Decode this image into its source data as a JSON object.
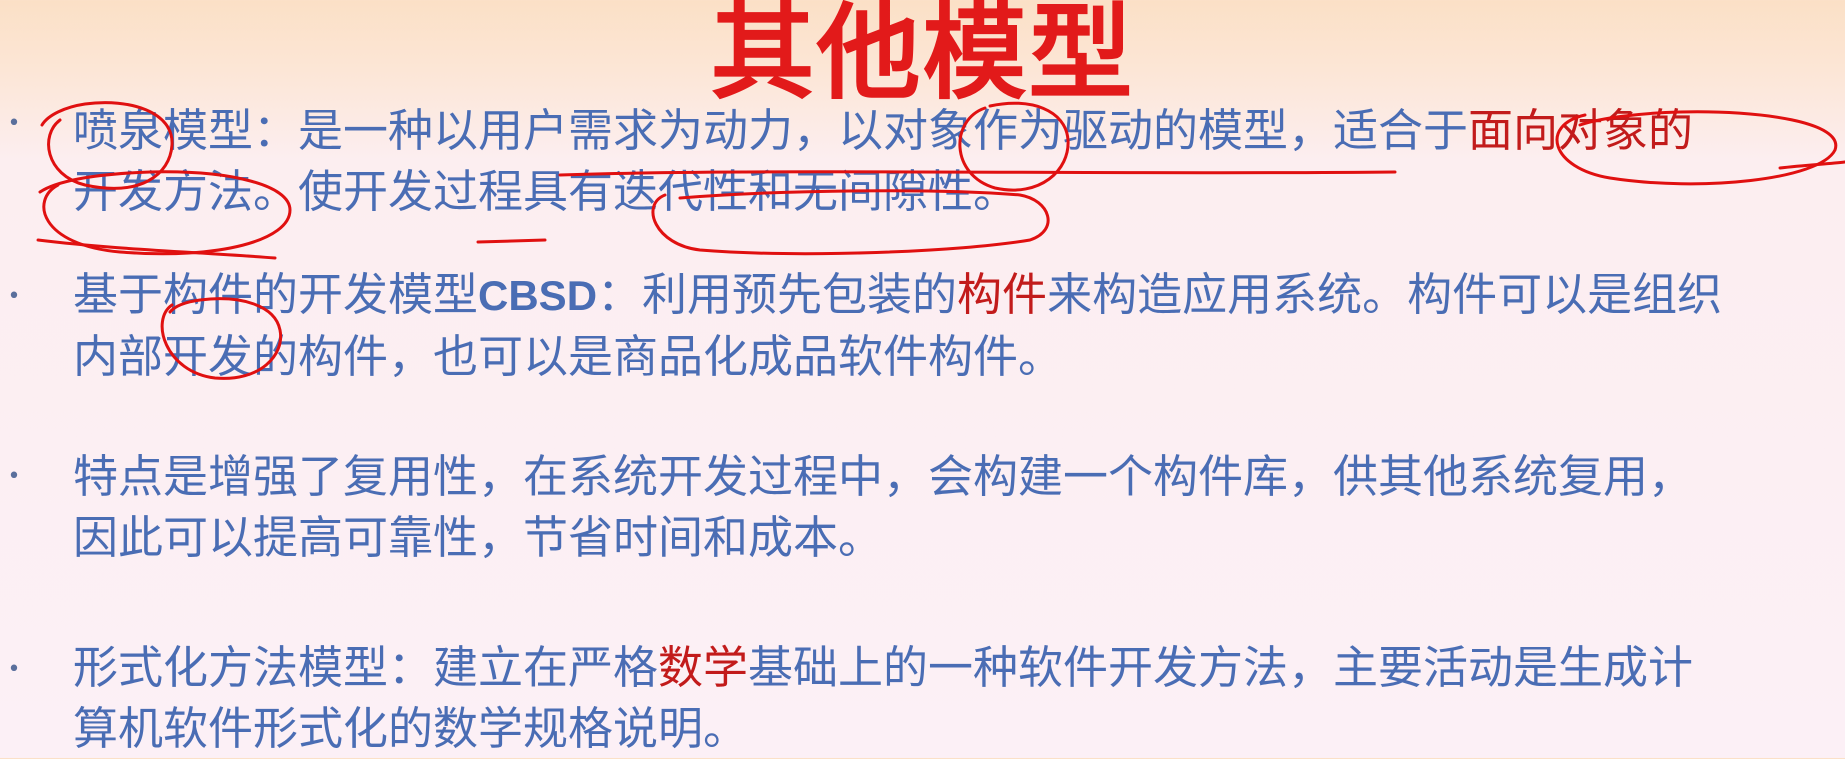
{
  "slide": {
    "title": "其他模型",
    "bullet_glyph": "•",
    "p1": {
      "line1": {
        "a": "喷泉模型：是一种以用户需求为动力，以对象作为驱动的模型，适合于",
        "b": "面向对象的"
      },
      "line2": "开发方法。使开发过程具有迭代性和无间隙性。"
    },
    "p2": {
      "line1": {
        "a": "基于构件的开发模型",
        "b": "CBSD",
        "c": "：利用预先包装的",
        "d": "构件",
        "e": "来构造应用系统。构件可以是组织"
      },
      "line2": "内部开发的构件，也可以是商品化成品软件构件。"
    },
    "p3": {
      "line1": "特点是增强了复用性，在系统开发过程中，会构建一个构件库，供其他系统复用，",
      "line2": "因此可以提高可靠性，节省时间和成本。"
    },
    "p4": {
      "line1": {
        "a": "形式化方法模型：建立在严格",
        "b": "数学",
        "c": "基础上的一种软件开发方法，主要活动是生成计"
      },
      "line2": "算机软件形式化的数学规格说明。"
    }
  },
  "colors": {
    "title": "#e21a1a",
    "body_text": "#4a6db4",
    "highlight": "#c21b1b",
    "annotation_ink": "#e01010"
  }
}
